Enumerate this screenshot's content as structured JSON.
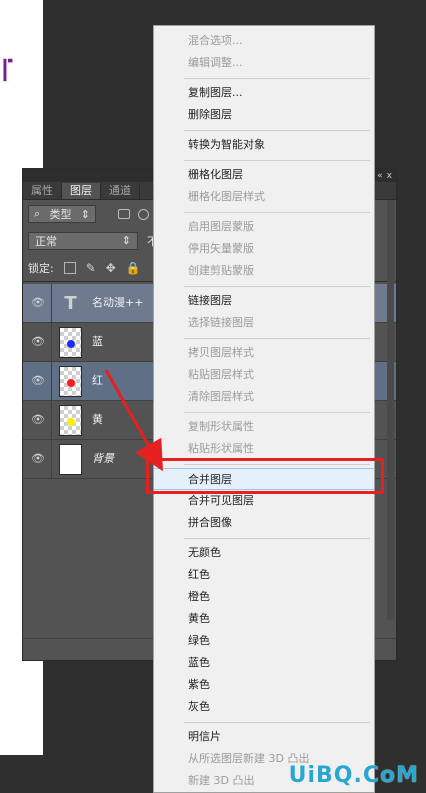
{
  "panel": {
    "tabs": [
      "属性",
      "图层",
      "通道"
    ],
    "active_tab_index": 1,
    "controls": [
      "«",
      "x"
    ],
    "filter": {
      "label": "类型",
      "search_icon": "search-icon"
    },
    "blend_mode": "正常",
    "opacity_label": "不",
    "lock_label": "锁定:",
    "layers": [
      {
        "name": "名动漫++",
        "type": "text",
        "thumb_char": "T",
        "visible": true
      },
      {
        "name": "蓝",
        "type": "dot",
        "dot_color": "#1f2cff",
        "visible": true
      },
      {
        "name": "红",
        "type": "dot",
        "dot_color": "#ff1d1d",
        "visible": true,
        "selected": true
      },
      {
        "name": "黄",
        "type": "dot",
        "dot_color": "#f7f000",
        "visible": true
      },
      {
        "name": "背景",
        "type": "background",
        "visible": true
      }
    ],
    "eye_icon": "eye-icon"
  },
  "menu": {
    "items": [
      {
        "label": "混合选项...",
        "disabled": true
      },
      {
        "label": "编辑调整...",
        "disabled": true
      },
      {
        "label": "复制图层...",
        "disabled": false
      },
      {
        "label": "删除图层",
        "disabled": false
      },
      {
        "label": "转换为智能对象",
        "disabled": false
      },
      {
        "label": "栅格化图层",
        "disabled": false
      },
      {
        "label": "栅格化图层样式",
        "disabled": true
      },
      {
        "label": "启用图层蒙版",
        "disabled": true
      },
      {
        "label": "停用矢量蒙版",
        "disabled": true
      },
      {
        "label": "创建剪贴蒙版",
        "disabled": true
      },
      {
        "label": "链接图层",
        "disabled": false
      },
      {
        "label": "选择链接图层",
        "disabled": true
      },
      {
        "label": "拷贝图层样式",
        "disabled": true
      },
      {
        "label": "粘贴图层样式",
        "disabled": true
      },
      {
        "label": "清除图层样式",
        "disabled": true
      },
      {
        "label": "复制形状属性",
        "disabled": true
      },
      {
        "label": "粘贴形状属性",
        "disabled": true
      },
      {
        "label": "合并图层",
        "disabled": false,
        "hovered": true
      },
      {
        "label": "合并可见图层",
        "disabled": false
      },
      {
        "label": "拼合图像",
        "disabled": false
      },
      {
        "label": "无颜色",
        "disabled": false
      },
      {
        "label": "红色",
        "disabled": false
      },
      {
        "label": "橙色",
        "disabled": false
      },
      {
        "label": "黄色",
        "disabled": false
      },
      {
        "label": "绿色",
        "disabled": false
      },
      {
        "label": "蓝色",
        "disabled": false
      },
      {
        "label": "紫色",
        "disabled": false
      },
      {
        "label": "灰色",
        "disabled": false
      },
      {
        "label": "明信片",
        "disabled": false
      },
      {
        "label": "从所选图层新建 3D 凸出",
        "disabled": true
      },
      {
        "label": "新建 3D 凸出",
        "disabled": true
      }
    ]
  },
  "annotations": {
    "highlight_color": "#e61f1f",
    "arrow_color": "#e61f1f"
  },
  "watermark": "UiBQ.CoM"
}
